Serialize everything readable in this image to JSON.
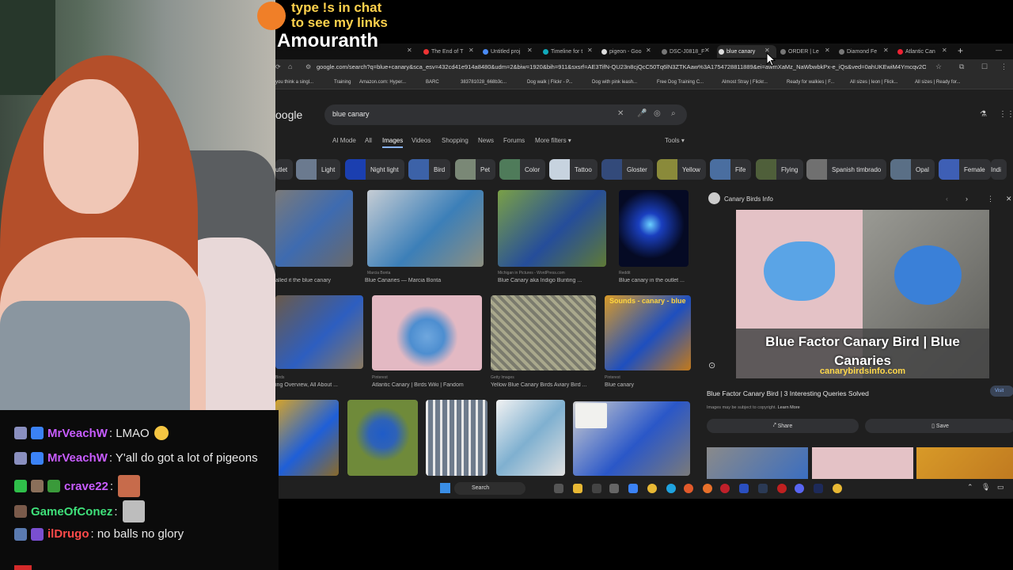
{
  "overlay": {
    "promo_line1": "type !s in chat",
    "promo_line2": "to see my links",
    "streamer_name": "Amouranth"
  },
  "browser": {
    "tabs": [
      {
        "label": "The End of T",
        "color": "#e33",
        "active": false
      },
      {
        "label": "Untitled proj",
        "color": "#4a8bf5",
        "active": false
      },
      {
        "label": "Timeline for t",
        "color": "#1ab",
        "active": false
      },
      {
        "label": "pigeon - Goo",
        "color": "#ddd",
        "active": false
      },
      {
        "label": "DSC-J0818_F",
        "color": "#ddd",
        "active": false
      },
      {
        "label": "blue canary",
        "color": "#ddd",
        "active": true
      },
      {
        "label": "ORDER | Le",
        "color": "#ddd",
        "active": false
      },
      {
        "label": "Diamond Fe",
        "color": "#ddd",
        "active": false
      },
      {
        "label": "Atlantic Can",
        "color": "#e23",
        "active": false
      }
    ],
    "url": "google.com/search?q=blue+canary&sca_esv=432cd41e914a8480&udm=2&biw=1920&bih=911&sxsrf=AE3TifN-QU23n8cjQcC50Tq6lN3ZTKAaw%3A1754728811889&ei=awmXaMz_NaWbwbkPx-e_iQs&ved=0ahUKEwiM4Ymcqv2OAx",
    "bookmarks": [
      "you think a singl...",
      "Training",
      "Amazon.com: Hyper...",
      "BARC",
      "383781028_668b3c...",
      "Dog walk | Flickr - P...",
      "Dog with pink leash...",
      "Free Dog Training C...",
      "Almost Stray | Flickr...",
      "Ready for walkies | F...",
      "All sizes | leon | Flick...",
      "All sizes | Ready for..."
    ],
    "google_logo": "oogle",
    "search_query": "blue canary",
    "search_tabs": [
      {
        "label": "AI Mode",
        "active": false
      },
      {
        "label": "All",
        "active": false
      },
      {
        "label": "Images",
        "active": true
      },
      {
        "label": "Videos",
        "active": false
      },
      {
        "label": "Shopping",
        "active": false
      },
      {
        "label": "News",
        "active": false
      },
      {
        "label": "Forums",
        "active": false
      },
      {
        "label": "More filters ▾",
        "active": false
      }
    ],
    "tools_label": "Tools ▾",
    "chips": [
      "utlet",
      "Light",
      "Night light",
      "Bird",
      "Pet",
      "Color",
      "Tattoo",
      "Gloster",
      "Yellow",
      "Fife",
      "Flying",
      "Spanish timbrado",
      "Opal",
      "Female",
      "Indi"
    ],
    "results_row1": [
      {
        "caption": "alled it the blue canary",
        "source": ""
      },
      {
        "caption": "Blue Canaries — Marcia Bonta",
        "source": "Marcia Bonta"
      },
      {
        "caption": "Blue Canary aka Indigo Bunting ...",
        "source": "Michigan in Pictures - WordPress.com"
      },
      {
        "caption": "Blue canary in the outlet ...",
        "source": "Reddit"
      }
    ],
    "results_row2": [
      {
        "caption": "ing Overview, All About ...",
        "source": "Birds"
      },
      {
        "caption": "Atlantic Canary | Birds Wiki | Fandom",
        "source": "Pinterest"
      },
      {
        "caption": "Yellow Blue Canary Birds Aviary Bird ...",
        "source": "Getty Images"
      },
      {
        "caption": "Blue canary",
        "source": "Pinterest"
      }
    ],
    "row2_overlay_text": "Sounds - canary - blue",
    "panel": {
      "source_name": "Canary Birds Info",
      "image_title": "Blue Factor Canary Bird | Blue Canaries",
      "image_site": "canarybirdsinfo.com",
      "heading": "Blue Factor Canary Bird | 3 Interesting Queries Solved",
      "note": "Images may be subject to copyright.",
      "learn_more": "Learn More",
      "visit": "Visit",
      "share": "Share",
      "save": "Save"
    },
    "taskbar_search": "Search"
  },
  "chat": {
    "messages": [
      {
        "user": "MrVeachW",
        "user_color": "#c85cff",
        "text": ": LMAO",
        "emote_color": ""
      },
      {
        "user": "MrVeachW",
        "user_color": "#c85cff",
        "text": ": Y'all do got a lot of pigeons",
        "emote_color": ""
      },
      {
        "user": "crave22",
        "user_color": "#c85cff",
        "text": ":",
        "emote_color": "#c76b4b"
      },
      {
        "user": "GameOfConez",
        "user_color": "#3fe07a",
        "text": ":",
        "emote_color": "#bdbdbd"
      },
      {
        "user": "ilDrugo",
        "user_color": "#ff4a4a",
        "text": ": no balls no glory",
        "emote_color": ""
      }
    ]
  },
  "colors": {
    "accent": "#8ab4f8",
    "panel_bg": "#1f1f1f",
    "chip_bg": "#303134"
  }
}
